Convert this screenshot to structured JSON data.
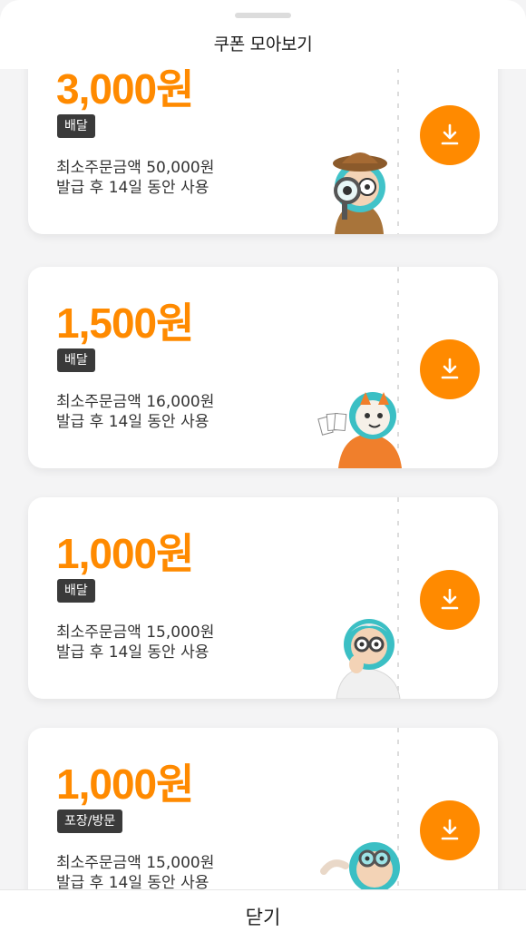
{
  "header": {
    "title": "쿠폰 모아보기"
  },
  "coupons": [
    {
      "amount": "3,000원",
      "badge": "배달",
      "min_order": "최소주문금액 50,000원",
      "validity": "발급 후 14일 동안 사용",
      "character": "detective-mascot"
    },
    {
      "amount": "1,500원",
      "badge": "배달",
      "min_order": "최소주문금액 16,000원",
      "validity": "발급 후 14일 동안 사용",
      "character": "cat-mascot-holding-cards"
    },
    {
      "amount": "1,000원",
      "badge": "배달",
      "min_order": "최소주문금액 15,000원",
      "validity": "발급 후 14일 동안 사용",
      "character": "scientist-mascot"
    },
    {
      "amount": "1,000원",
      "badge": "포장/방문",
      "min_order": "최소주문금액 15,000원",
      "validity": "발급 후 14일 동안 사용",
      "character": "goggles-mascot"
    }
  ],
  "footer": {
    "close_label": "닫기"
  },
  "icons": {
    "download": "download-icon"
  },
  "colors": {
    "accent": "#ff8a00",
    "badge_bg": "#3a3a3a",
    "background": "#f4f4f5"
  }
}
